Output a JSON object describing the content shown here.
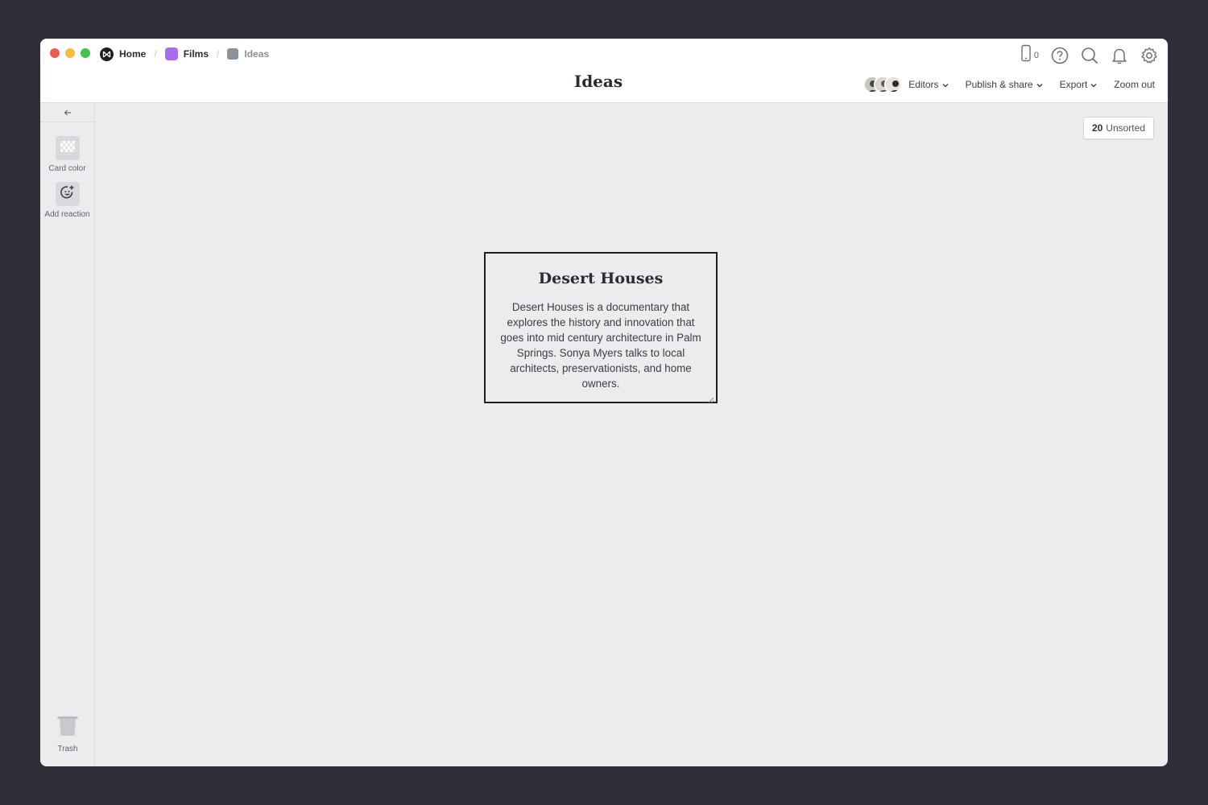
{
  "breadcrumb": {
    "home": "Home",
    "films": "Films",
    "current": "Ideas"
  },
  "header": {
    "title": "Ideas",
    "phone_count": "0"
  },
  "toolbar": {
    "editors": "Editors",
    "publish": "Publish & share",
    "export": "Export",
    "zoom": "Zoom out"
  },
  "sidebar": {
    "card_color": "Card color",
    "add_reaction": "Add reaction",
    "trash": "Trash"
  },
  "unsorted": {
    "count": "20",
    "label": "Unsorted"
  },
  "card": {
    "title": "Desert Houses",
    "body": "Desert Houses is a documentary that explores the history and innovation that goes into mid century architecture in Palm Springs. Sonya Myers talks to local architects, preservationists, and home owners."
  },
  "colors": {
    "films_icon": "#a86cf0",
    "ideas_icon": "#8a929c",
    "backdrop": "#302e38",
    "canvas": "#ebecee"
  },
  "icons": [
    "home-logo-icon",
    "films-square-icon",
    "ideas-square-icon",
    "phone-icon",
    "help-icon",
    "search-icon",
    "bell-icon",
    "gear-icon",
    "chevron-down-icon",
    "arrow-left-icon",
    "checkerboard-icon",
    "emoji-add-icon",
    "trash-icon"
  ]
}
